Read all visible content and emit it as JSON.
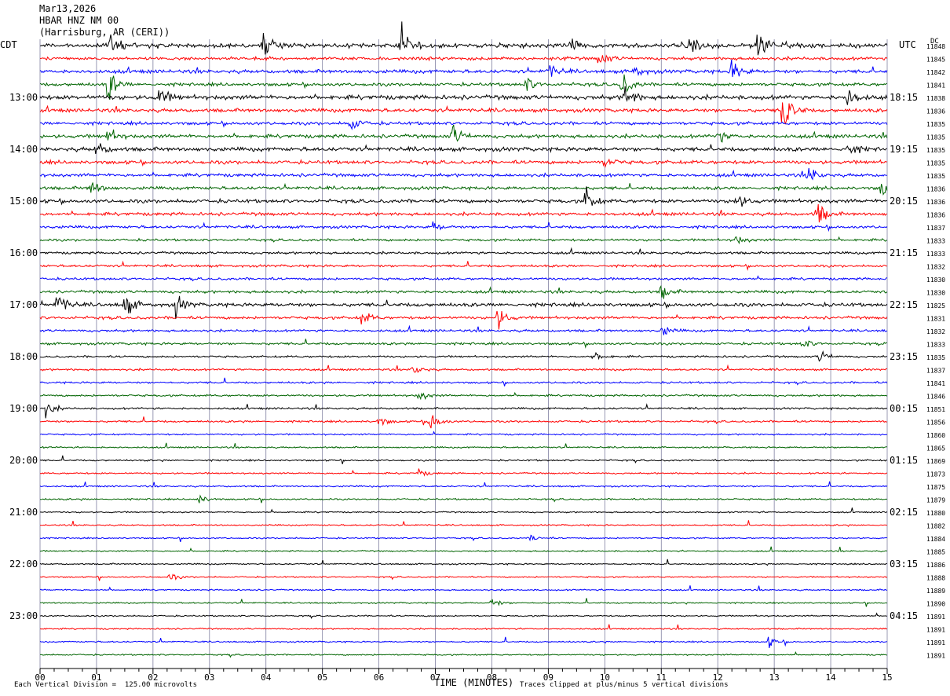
{
  "header": {
    "date": "Mar13,2026",
    "station": "HBAR HNZ NM 00",
    "location": "(Harrisburg, AR (CERI))"
  },
  "left_tz": "CDT",
  "right_tz": "UTC",
  "dc_header": "DC",
  "footer": {
    "scale_note": "Each Vertical Division =  125.00 microvolts",
    "xlabel": "TIME (MINUTES)",
    "clip_note": "Traces clipped at plus/minus 5 vertical divisions"
  },
  "colors": {
    "trace_cycle": [
      "#000000",
      "#ff0000",
      "#0000ff",
      "#006400"
    ],
    "grid": "#7f7fa0"
  },
  "chart_data": {
    "type": "line",
    "subtype": "helicorder",
    "xlabel": "TIME (MINUTES)",
    "xlim": [
      0,
      15
    ],
    "x_ticks": [
      "00",
      "01",
      "02",
      "03",
      "04",
      "05",
      "06",
      "07",
      "08",
      "09",
      "10",
      "11",
      "12",
      "13",
      "14",
      "15"
    ],
    "trace_interval_minutes": 15,
    "trace_count": 48,
    "left_time_labels": [
      "13:00",
      "14:00",
      "15:00",
      "16:00",
      "17:00",
      "18:00",
      "19:00",
      "20:00",
      "21:00",
      "22:00",
      "23:00"
    ],
    "right_time_labels": [
      "18:15",
      "19:15",
      "20:15",
      "21:15",
      "22:15",
      "23:15",
      "00:15",
      "01:15",
      "02:15",
      "03:15",
      "04:15"
    ],
    "time_label_first_trace": 4,
    "time_label_every": 4,
    "dc_offsets": [
      11848,
      11845,
      11842,
      11841,
      11838,
      11836,
      11835,
      11835,
      11835,
      11835,
      11835,
      11836,
      11836,
      11836,
      11837,
      11833,
      11833,
      11832,
      11830,
      11830,
      11825,
      11831,
      11832,
      11833,
      11835,
      11837,
      11841,
      11846,
      11851,
      11856,
      11860,
      11865,
      11869,
      11873,
      11875,
      11879,
      11880,
      11882,
      11884,
      11885,
      11886,
      11888,
      11889,
      11890,
      11891,
      11891,
      11891,
      11891
    ],
    "noise_levels": [
      2.2,
      1.6,
      1.8,
      1.6,
      2.2,
      1.8,
      1.6,
      1.8,
      2.0,
      1.8,
      1.6,
      1.6,
      1.8,
      1.6,
      1.4,
      1.2,
      1.2,
      1.2,
      1.2,
      1.4,
      1.8,
      1.4,
      1.2,
      1.2,
      1.0,
      1.0,
      1.0,
      1.0,
      1.0,
      1.0,
      0.8,
      0.8,
      0.8,
      0.8,
      0.8,
      0.8,
      0.7,
      0.7,
      0.7,
      0.7,
      0.7,
      0.7,
      0.7,
      0.7,
      0.7,
      0.7,
      0.7,
      0.7
    ],
    "events": [
      {
        "trace": 0,
        "minute": 1.25,
        "amp": 1.0
      },
      {
        "trace": 0,
        "minute": 3.95,
        "amp": 1.2
      },
      {
        "trace": 0,
        "minute": 6.4,
        "amp": 1.2
      },
      {
        "trace": 0,
        "minute": 12.7,
        "amp": 1.5
      },
      {
        "trace": 0,
        "minute": 9.4,
        "amp": 0.6
      },
      {
        "trace": 0,
        "minute": 11.5,
        "amp": 0.6
      },
      {
        "trace": 1,
        "minute": 9.9,
        "amp": 0.6
      },
      {
        "trace": 2,
        "minute": 12.25,
        "amp": 0.9
      },
      {
        "trace": 2,
        "minute": 9.0,
        "amp": 0.6
      },
      {
        "trace": 2,
        "minute": 10.5,
        "amp": 0.5
      },
      {
        "trace": 3,
        "minute": 1.2,
        "amp": 1.3
      },
      {
        "trace": 3,
        "minute": 10.3,
        "amp": 1.0
      },
      {
        "trace": 3,
        "minute": 8.6,
        "amp": 0.6
      },
      {
        "trace": 4,
        "minute": 2.1,
        "amp": 0.8
      },
      {
        "trace": 4,
        "minute": 10.35,
        "amp": 1.0
      },
      {
        "trace": 4,
        "minute": 14.3,
        "amp": 0.8
      },
      {
        "trace": 5,
        "minute": 13.15,
        "amp": 2.5
      },
      {
        "trace": 6,
        "minute": 5.5,
        "amp": 0.6
      },
      {
        "trace": 7,
        "minute": 7.3,
        "amp": 0.9
      },
      {
        "trace": 7,
        "minute": 1.2,
        "amp": 0.6
      },
      {
        "trace": 7,
        "minute": 12.0,
        "amp": 0.6
      },
      {
        "trace": 8,
        "minute": 1.0,
        "amp": 0.6
      },
      {
        "trace": 8,
        "minute": 14.3,
        "amp": 0.5
      },
      {
        "trace": 9,
        "minute": 10.0,
        "amp": 0.4
      },
      {
        "trace": 10,
        "minute": 13.6,
        "amp": 0.8
      },
      {
        "trace": 11,
        "minute": 0.9,
        "amp": 0.7
      },
      {
        "trace": 11,
        "minute": 14.9,
        "amp": 0.7
      },
      {
        "trace": 12,
        "minute": 9.65,
        "amp": 1.0
      },
      {
        "trace": 12,
        "minute": 12.3,
        "amp": 0.8
      },
      {
        "trace": 13,
        "minute": 13.75,
        "amp": 1.1
      },
      {
        "trace": 14,
        "minute": 6.95,
        "amp": 0.4
      },
      {
        "trace": 15,
        "minute": 12.3,
        "amp": 0.4
      },
      {
        "trace": 19,
        "minute": 11.0,
        "amp": 0.6
      },
      {
        "trace": 20,
        "minute": 0.3,
        "amp": 1.0
      },
      {
        "trace": 20,
        "minute": 1.5,
        "amp": 1.0
      },
      {
        "trace": 20,
        "minute": 2.4,
        "amp": 0.8
      },
      {
        "trace": 21,
        "minute": 5.7,
        "amp": 0.6
      },
      {
        "trace": 21,
        "minute": 8.1,
        "amp": 0.9
      },
      {
        "trace": 22,
        "minute": 11.0,
        "amp": 0.5
      },
      {
        "trace": 23,
        "minute": 13.5,
        "amp": 0.4
      },
      {
        "trace": 24,
        "minute": 9.8,
        "amp": 0.4
      },
      {
        "trace": 24,
        "minute": 13.8,
        "amp": 0.5
      },
      {
        "trace": 25,
        "minute": 6.6,
        "amp": 0.5
      },
      {
        "trace": 27,
        "minute": 6.7,
        "amp": 0.4
      },
      {
        "trace": 28,
        "minute": 0.1,
        "amp": 0.6
      },
      {
        "trace": 29,
        "minute": 6.9,
        "amp": 0.9
      },
      {
        "trace": 29,
        "minute": 6.0,
        "amp": 0.4
      },
      {
        "trace": 33,
        "minute": 6.7,
        "amp": 0.3
      },
      {
        "trace": 35,
        "minute": 2.8,
        "amp": 0.4
      },
      {
        "trace": 38,
        "minute": 8.7,
        "amp": 0.3
      },
      {
        "trace": 41,
        "minute": 2.3,
        "amp": 0.3
      },
      {
        "trace": 43,
        "minute": 8.0,
        "amp": 0.4
      },
      {
        "trace": 46,
        "minute": 12.9,
        "amp": 0.4
      }
    ]
  }
}
